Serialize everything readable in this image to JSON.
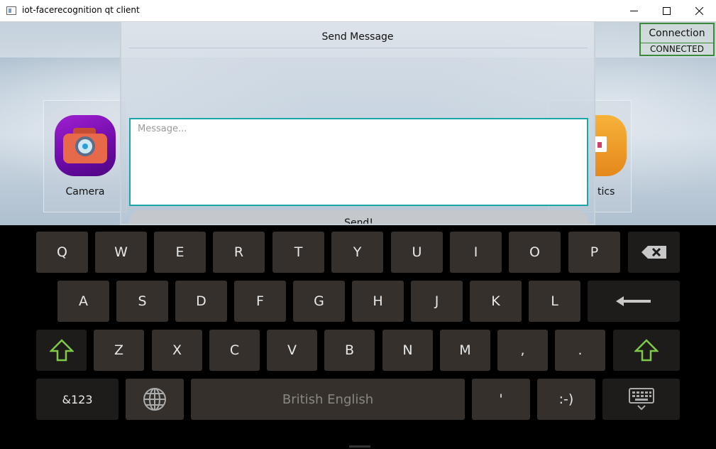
{
  "window": {
    "title": "iot-facerecognition qt client",
    "buttons": [
      "minimize",
      "maximize",
      "close"
    ]
  },
  "tiles": [
    {
      "label": "Camera",
      "icon": "camera-icon"
    },
    {
      "label": "tics",
      "icon": "statistics-icon"
    }
  ],
  "connection": {
    "title": "Connection",
    "status": "CONNECTED",
    "status_color": "#3a8a3a"
  },
  "dialog": {
    "title": "Send Message",
    "message_value": "",
    "message_placeholder": "Message...",
    "send_label": "Send!",
    "accent": "#1aa6a6"
  },
  "keyboard": {
    "row1": [
      "Q",
      "W",
      "E",
      "R",
      "T",
      "Y",
      "U",
      "I",
      "O",
      "P"
    ],
    "row2": [
      "A",
      "S",
      "D",
      "F",
      "G",
      "H",
      "J",
      "K",
      "L"
    ],
    "row3": [
      "Z",
      "X",
      "C",
      "V",
      "B",
      "N",
      "M",
      ",",
      "."
    ],
    "symbols_label": "&123",
    "language_label": "British English",
    "apostrophe": "'",
    "smiley": ":-)",
    "icons": [
      "backspace-icon",
      "enter-icon",
      "shift-icon",
      "globe-icon",
      "hide-keyboard-icon"
    ],
    "shift_color": "#7ec94a"
  }
}
